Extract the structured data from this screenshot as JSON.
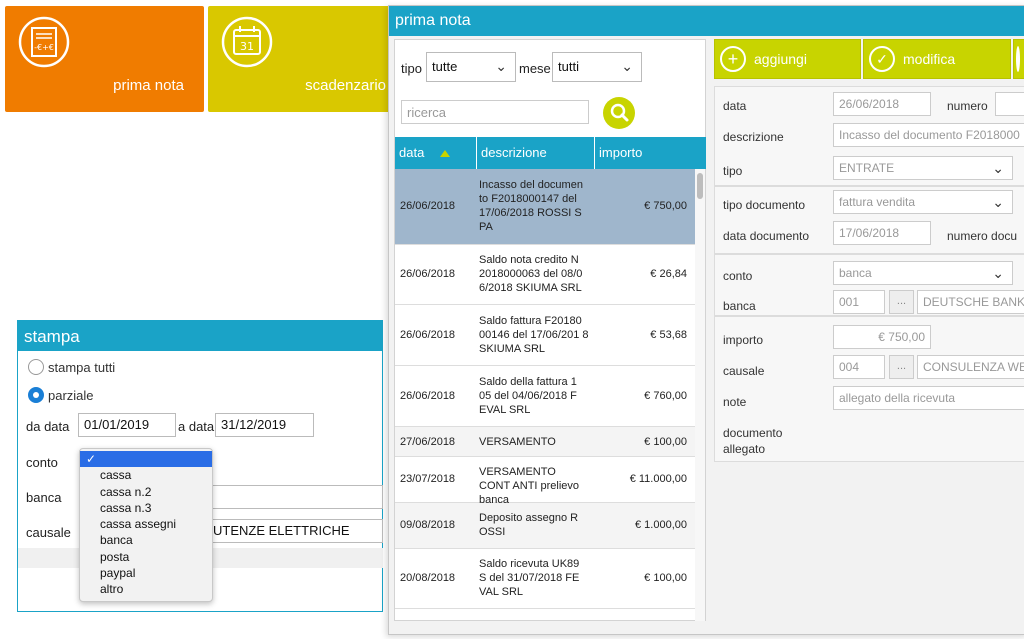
{
  "tiles": [
    {
      "label": "prima nota",
      "color": "#f07c00",
      "icon": "invoice-icon"
    },
    {
      "label": "scadenzario",
      "color": "#d9c800",
      "icon": "calendar-icon",
      "day": "31"
    }
  ],
  "stampa": {
    "title": "stampa",
    "radio_all": "stampa tutti",
    "radio_partial": "parziale",
    "da_data_label": "da data",
    "da_data_value": "01/01/2019",
    "a_data_label": "a data",
    "a_data_value": "31/12/2019",
    "conto_label": "conto",
    "banca_label": "banca",
    "causale_label": "causale",
    "causale_value": "UTENZE ELETTRICHE",
    "conto_options_checkmark": "✓",
    "conto_options": [
      "cassa",
      "cassa n.2",
      "cassa n.3",
      "cassa assegni",
      "banca",
      "posta",
      "paypal",
      "altro"
    ]
  },
  "prima_nota": {
    "title": "prima nota",
    "filters": {
      "tipo_label": "tipo",
      "tipo_value": "tutte",
      "mese_label": "mese",
      "mese_value": "tutti",
      "search_placeholder": "ricerca"
    },
    "table": {
      "headers": [
        "data",
        "descrizione",
        "importo"
      ],
      "rows": [
        {
          "date": "26/06/2018",
          "desc": "Incasso del documen to F2018000147 del 17/06/2018 ROSSI S PA",
          "amount": "€ 750,00",
          "selected": true
        },
        {
          "date": "26/06/2018",
          "desc": "Saldo nota credito N 2018000063 del 08/0 6/2018 SKIUMA SRL",
          "amount": "€ 26,84"
        },
        {
          "date": "26/06/2018",
          "desc": "Saldo fattura F20180 00146 del 17/06/201 8 SKIUMA SRL",
          "amount": "€ 53,68"
        },
        {
          "date": "26/06/2018",
          "desc": "Saldo della fattura 1 05 del 04/06/2018 F EVAL SRL",
          "amount": "€ 760,00"
        },
        {
          "date": "27/06/2018",
          "desc": "VERSAMENTO",
          "amount": "€ 100,00"
        },
        {
          "date": "23/07/2018",
          "desc": "VERSAMENTO CONT ANTI prelievo banca",
          "amount": "€ 11.000,00"
        },
        {
          "date": "09/08/2018",
          "desc": "Deposito assegno R OSSI",
          "amount": "€ 1.000,00"
        },
        {
          "date": "20/08/2018",
          "desc": "Saldo ricevuta UK89 S del 31/07/2018 FE VAL SRL",
          "amount": "€ 100,00"
        }
      ]
    },
    "toolbar": {
      "add_label": "aggiungi",
      "edit_label": "modifica"
    },
    "form": {
      "data_label": "data",
      "data_value": "26/06/2018",
      "numero_label": "numero",
      "descrizione_label": "descrizione",
      "descrizione_value": "Incasso del documento F2018000",
      "tipo_label": "tipo",
      "tipo_value": "ENTRATE",
      "tipo_documento_label": "tipo documento",
      "tipo_documento_value": "fattura vendita",
      "data_documento_label": "data documento",
      "data_documento_value": "17/06/2018",
      "numero_documento_label": "numero docu",
      "conto_label": "conto",
      "conto_value": "banca",
      "banca_label": "banca",
      "banca_code": "001",
      "banca_name": "DEUTSCHE BANK",
      "dots": "...",
      "importo_label": "importo",
      "importo_value": "€ 750,00",
      "causale_label": "causale",
      "causale_code": "004",
      "causale_name": "CONSULENZA WE",
      "note_label": "note",
      "note_value": "allegato della ricevuta",
      "documento_allegato_label": "documento allegato"
    }
  }
}
